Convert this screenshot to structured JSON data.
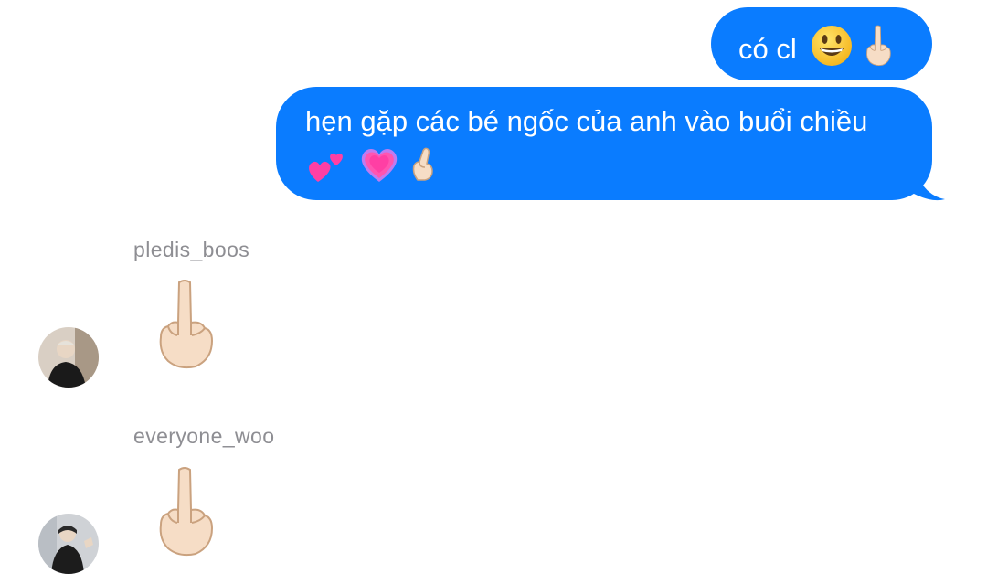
{
  "messages": {
    "sent": [
      {
        "text": "có cl",
        "emojis": [
          "smiley-icon",
          "middle-finger-icon"
        ]
      },
      {
        "text": "hẹn gặp các bé ngốc của anh vào buổi chiều",
        "emojis": [
          "two-hearts-icon",
          "growing-heart-icon",
          "finger-heart-icon"
        ]
      }
    ],
    "received": [
      {
        "sender": "pledis_boos",
        "content": "middle-finger-icon"
      },
      {
        "sender": "everyone_woo",
        "content": "middle-finger-icon"
      }
    ]
  },
  "colors": {
    "sent_bubble": "#0a7cff",
    "sent_text": "#ffffff",
    "sender_name": "#8e8e93"
  }
}
